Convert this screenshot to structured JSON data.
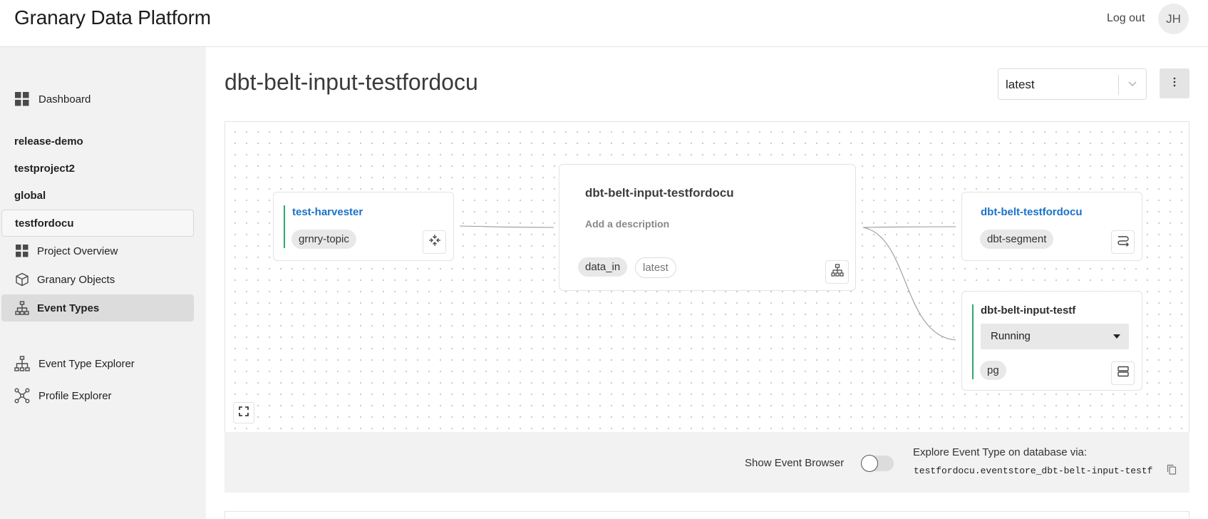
{
  "header": {
    "app_title": "Granary Data Platform",
    "logout_label": "Log out",
    "avatar_initials": "JH"
  },
  "sidebar": {
    "dashboard": "Dashboard",
    "projects": [
      "release-demo",
      "testproject2",
      "global",
      "testfordocu"
    ],
    "project_nav": [
      "Project Overview",
      "Granary Objects",
      "Event Types"
    ],
    "tools": [
      "Event Type Explorer",
      "Profile Explorer"
    ]
  },
  "main": {
    "title": "dbt-belt-input-testfordocu",
    "version_select": {
      "value": "latest"
    }
  },
  "graph": {
    "source_node": {
      "name": "test-harvester",
      "chip": "grnry-topic",
      "icon": "merge-arrows-icon"
    },
    "center_node": {
      "title": "dbt-belt-input-testfordocu",
      "description_placeholder": "Add a description",
      "chip": "data_in",
      "version_chip": "latest",
      "icon": "hierarchy-icon"
    },
    "target_nodes": [
      {
        "name": "dbt-belt-testfordocu",
        "chip": "dbt-segment",
        "icon": "route-icon"
      },
      {
        "name": "dbt-belt-input-testf",
        "status": "Running",
        "chip": "pg",
        "icon": "database-icon"
      }
    ]
  },
  "bottom": {
    "show_browser_label": "Show Event Browser",
    "show_browser_on": false,
    "explore_label": "Explore Event Type on database via:",
    "explore_path": "testfordocu.eventstore_dbt-belt-input-testf"
  },
  "colors": {
    "accent_green": "#2fa86b",
    "link_blue": "#1a73c8",
    "sidebar_bg": "#f2f2f2",
    "active_bg": "#dcdcdc"
  }
}
